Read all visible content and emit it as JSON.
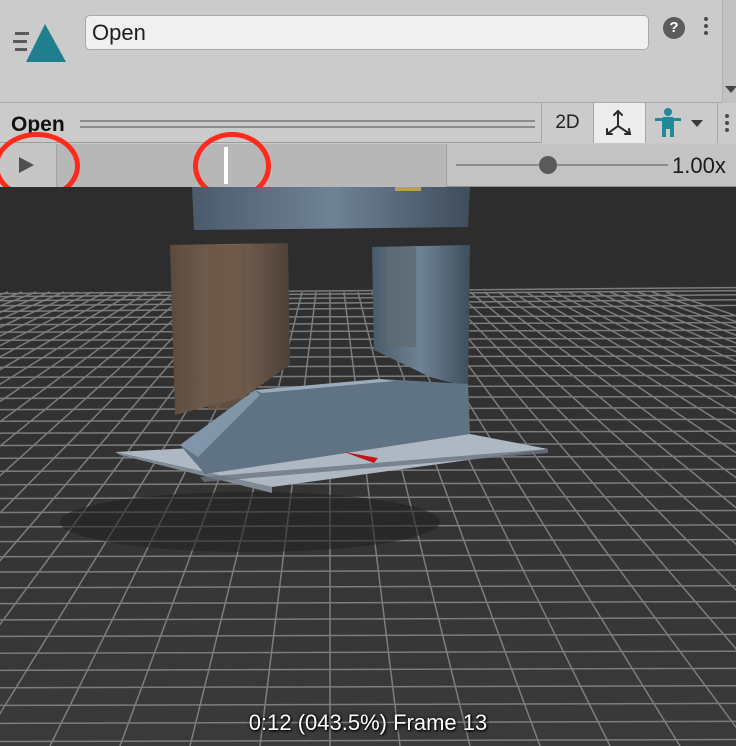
{
  "header": {
    "asset_icon": "animation-clip-icon",
    "name_value": "Open",
    "help_icon": "help-icon",
    "help_glyph": "?",
    "menu_icon": "kebab-menu-icon"
  },
  "preview": {
    "title": "Open",
    "buttons": {
      "mode_2d": "2D",
      "pivot_icon": "pivot-icon",
      "avatar_icon": "avatar-icon",
      "menu_icon": "kebab-menu-icon"
    }
  },
  "playback": {
    "play_icon": "play-icon",
    "timeline_progress": 0.435,
    "speed_slider_value": 0.5,
    "speed_label": "1.00x"
  },
  "viewport": {
    "time_readout": "0:12 (043.5%) Frame 13"
  },
  "colors": {
    "annotation": "#ff2a1c",
    "accent_teal": "#1f7f8f",
    "viewport_bg": "#333333"
  }
}
